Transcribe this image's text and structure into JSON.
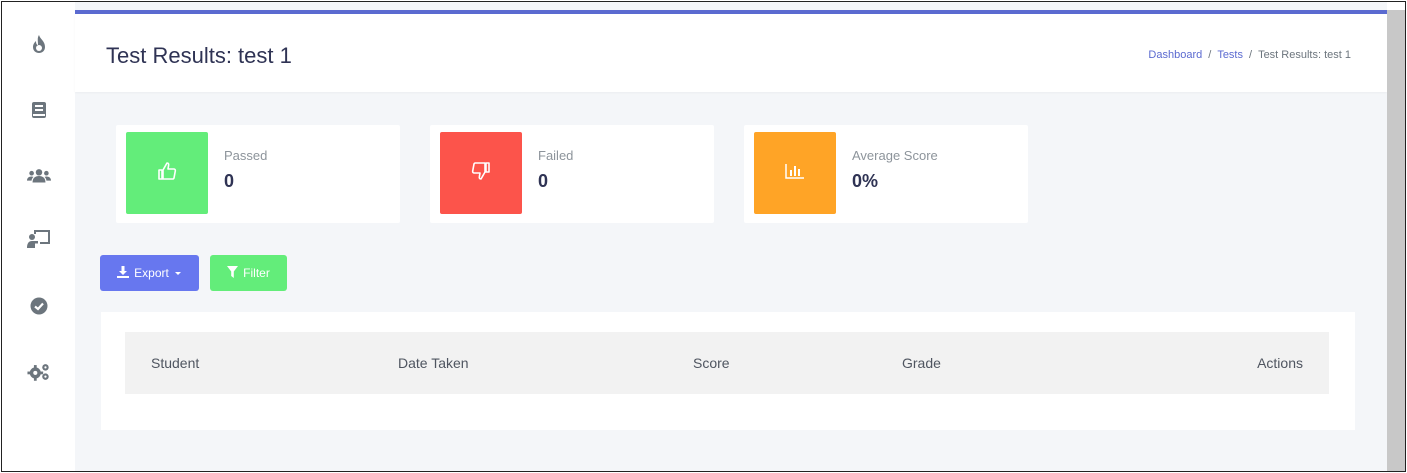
{
  "sidebar": {
    "icons": [
      "fire-icon",
      "book-icon",
      "users-icon",
      "chalkboard-teacher-icon",
      "check-circle-icon",
      "cogs-icon"
    ]
  },
  "header": {
    "title": "Test Results: test 1",
    "breadcrumb": [
      "Dashboard",
      "Tests",
      "Test Results: test 1"
    ],
    "breadcrumb_sep": "/"
  },
  "stats": [
    {
      "label": "Passed",
      "value": "0",
      "icon": "thumbs-up-icon",
      "color": "#63ed7a"
    },
    {
      "label": "Failed",
      "value": "0",
      "icon": "thumbs-down-icon",
      "color": "#fc544b"
    },
    {
      "label": "Average Score",
      "value": "0%",
      "icon": "chart-bar-icon",
      "color": "#ffa426"
    }
  ],
  "toolbar": {
    "export_label": "Export",
    "filter_label": "Filter"
  },
  "table": {
    "columns": [
      "Student",
      "Date Taken",
      "Score",
      "Grade",
      "Actions"
    ]
  },
  "colors": {
    "accent": "#6777ef",
    "topbar": "#5b6ad0"
  }
}
